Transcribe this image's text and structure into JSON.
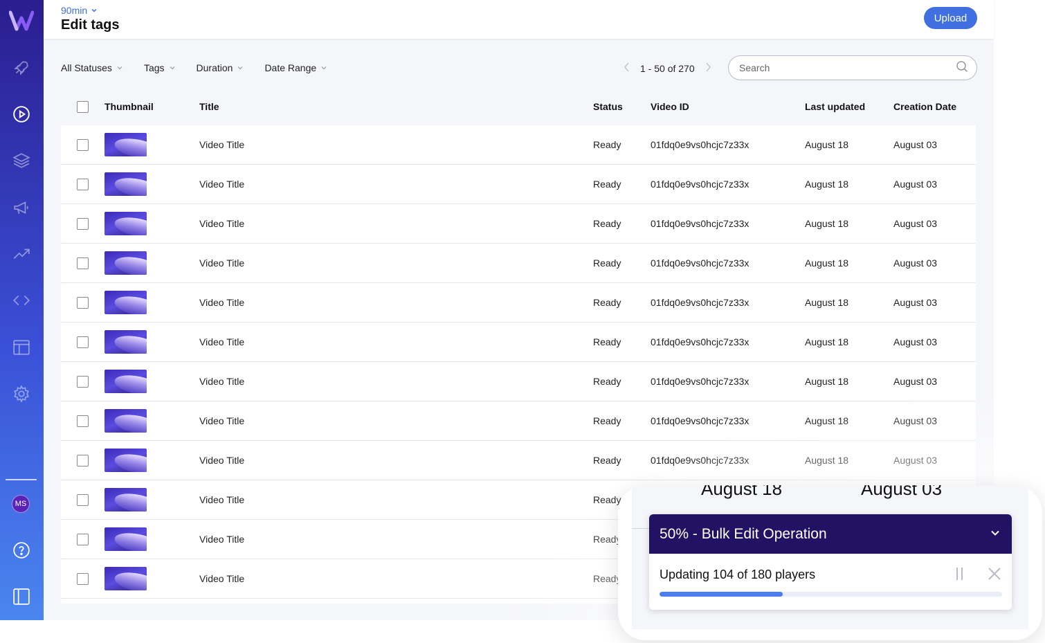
{
  "app": {
    "accent": "#3f6fe0",
    "sidebar_top": "#2a1d8f",
    "sidebar_bottom": "#4a86f0"
  },
  "sidebar": {
    "icons": [
      "logo-icon",
      "rocket-icon",
      "play-circle-icon",
      "layers-icon",
      "megaphone-icon",
      "trending-icon",
      "code-icon",
      "layout-icon",
      "gear-icon",
      "help-icon",
      "panel-icon"
    ],
    "avatar": "MS"
  },
  "header": {
    "breadcrumb": "90min",
    "title": "Edit tags",
    "upload_label": "Upload"
  },
  "filters": [
    "All Statuses",
    "Tags",
    "Duration",
    "Date Range"
  ],
  "pagination": {
    "text": "1 - 50 of 270"
  },
  "search": {
    "placeholder": "Search",
    "value": ""
  },
  "table": {
    "columns": [
      "Thumbnail",
      "Title",
      "Status",
      "Video ID",
      "Last updated",
      "Creation Date"
    ],
    "rows": [
      {
        "title": "Video Title",
        "status": "Ready",
        "video_id": "01fdq0e9vs0hcjc7z33x",
        "last_updated": "August 18",
        "created": "August 03"
      },
      {
        "title": "Video Title",
        "status": "Ready",
        "video_id": "01fdq0e9vs0hcjc7z33x",
        "last_updated": "August 18",
        "created": "August 03"
      },
      {
        "title": "Video Title",
        "status": "Ready",
        "video_id": "01fdq0e9vs0hcjc7z33x",
        "last_updated": "August 18",
        "created": "August 03"
      },
      {
        "title": "Video Title",
        "status": "Ready",
        "video_id": "01fdq0e9vs0hcjc7z33x",
        "last_updated": "August 18",
        "created": "August 03"
      },
      {
        "title": "Video Title",
        "status": "Ready",
        "video_id": "01fdq0e9vs0hcjc7z33x",
        "last_updated": "August 18",
        "created": "August 03"
      },
      {
        "title": "Video Title",
        "status": "Ready",
        "video_id": "01fdq0e9vs0hcjc7z33x",
        "last_updated": "August 18",
        "created": "August 03"
      },
      {
        "title": "Video Title",
        "status": "Ready",
        "video_id": "01fdq0e9vs0hcjc7z33x",
        "last_updated": "August 18",
        "created": "August 03"
      },
      {
        "title": "Video Title",
        "status": "Ready",
        "video_id": "01fdq0e9vs0hcjc7z33x",
        "last_updated": "August 18",
        "created": "August 03"
      },
      {
        "title": "Video Title",
        "status": "Ready",
        "video_id": "01fdq0e9vs0hcjc7z33x",
        "last_updated": "August 18",
        "created": "August 03"
      },
      {
        "title": "Video Title",
        "status": "Ready",
        "video_id": "",
        "last_updated": "",
        "created": ""
      },
      {
        "title": "Video Title",
        "status": "Ready",
        "video_id": "",
        "last_updated": "",
        "created": ""
      },
      {
        "title": "Video Title",
        "status": "Ready",
        "video_id": "",
        "last_updated": "",
        "created": ""
      }
    ]
  },
  "zoom_background": {
    "left_text": "August 18",
    "right_text": "August 03"
  },
  "bulk_operation": {
    "title": "50% - Bulk Edit Operation",
    "message": "Updating 104 of 180 players",
    "progress_percent": 36
  }
}
